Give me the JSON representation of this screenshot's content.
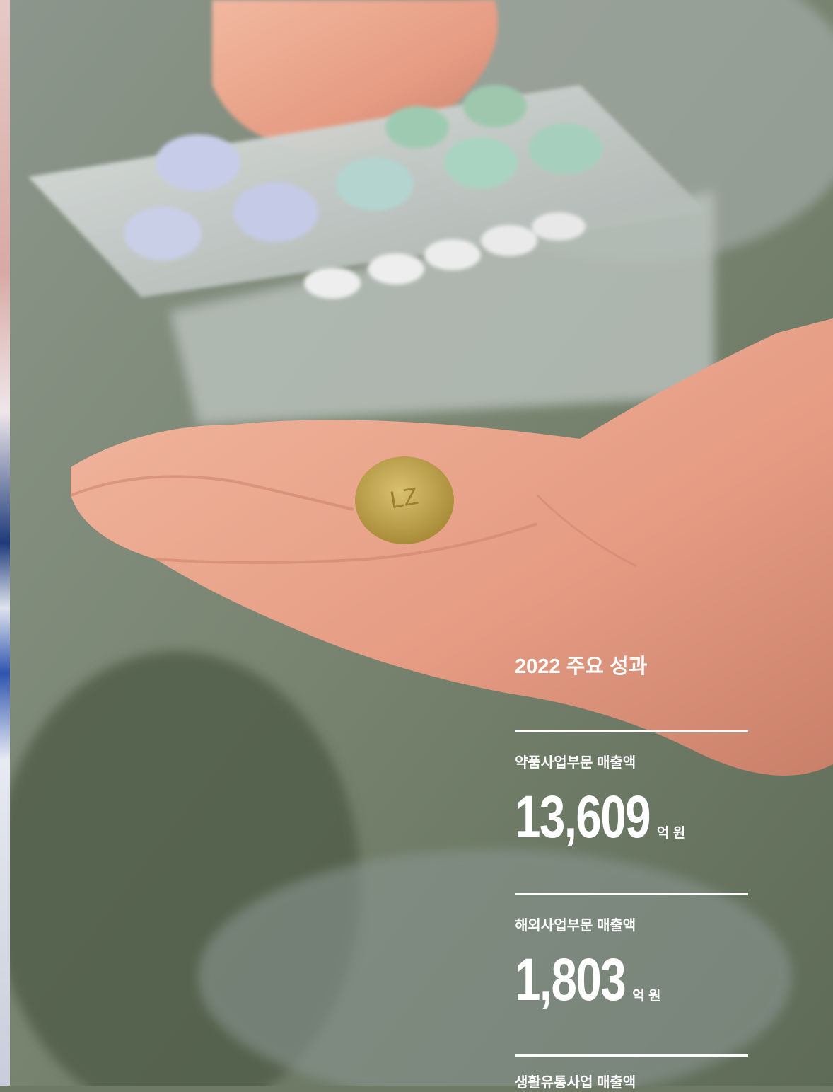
{
  "colors": {
    "text": "#ffffff",
    "rule": "#ffffff",
    "pill": "#c8aa55"
  },
  "stats": {
    "title": "2022 주요 성과",
    "metrics": [
      {
        "label": "약품사업부문 매출액",
        "value": "13,609",
        "unit": "억 원"
      },
      {
        "label": "해외사업부문 매출액",
        "value": "1,803",
        "unit": "억 원"
      },
      {
        "label": "생활유통사업 매출액",
        "value": "",
        "unit": ""
      }
    ]
  },
  "photo": {
    "pill_imprint": "LZ"
  }
}
